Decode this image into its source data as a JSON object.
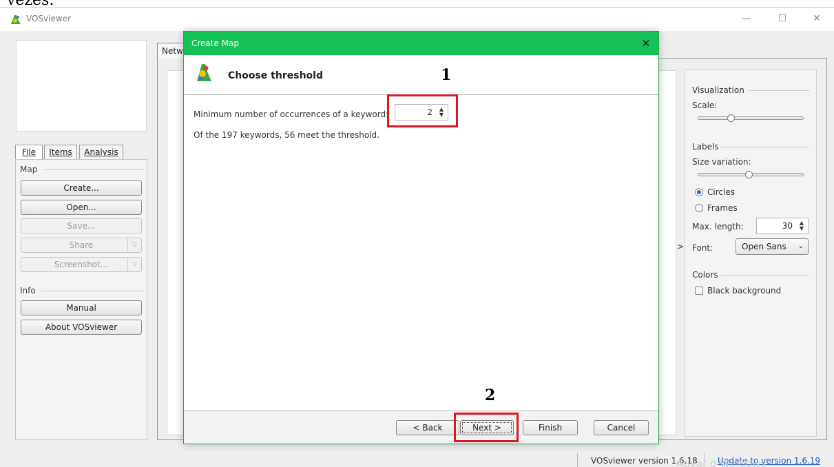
{
  "top_clipped_text": "vezes.",
  "window": {
    "title": "VOSviewer",
    "controls": {
      "minimize": "—",
      "maximize": "☐",
      "close": "✕"
    }
  },
  "left_panel": {
    "tabs": [
      "File",
      "Items",
      "Analysis"
    ],
    "map_group": "Map",
    "buttons": {
      "create": "Create...",
      "open": "Open...",
      "save": "Save...",
      "share": "Share",
      "screenshot": "Screenshot..."
    },
    "info_group": "Info",
    "info_buttons": {
      "manual": "Manual",
      "about": "About VOSviewer"
    }
  },
  "main": {
    "tab_label": "Netw",
    "expand_arrow": ">"
  },
  "right_panel": {
    "visualization": "Visualization",
    "scale": "Scale:",
    "labels": "Labels",
    "size_variation": "Size variation:",
    "circles": "Circles",
    "frames": "Frames",
    "max_length_label": "Max. length:",
    "max_length_value": "30",
    "font_label": "Font:",
    "font_value": "Open Sans",
    "colors": "Colors",
    "black_background": "Black background",
    "scale_level": 0.3,
    "size_variation_level": 0.48
  },
  "dialog": {
    "title": "Create Map",
    "close": "✕",
    "heading": "Choose threshold",
    "field_label": "Minimum number of occurrences of a keyword:",
    "field_value": "2",
    "info_text": "Of the 197 keywords, 56 meet the threshold.",
    "buttons": {
      "back": "< Back",
      "next": "Next >",
      "finish": "Finish",
      "cancel": "Cancel"
    }
  },
  "annotations": {
    "one": "1",
    "two": "2"
  },
  "status": {
    "version": "VOSviewer version 1.6.18",
    "update_link": "Update to version 1.6.19",
    "watermark": "Ativar o Windows"
  },
  "colors": {
    "dialog_title_bg": "#16c257",
    "annotation_red": "#e01522",
    "link": "#1a55c8",
    "radio_selected": "#2c6fb8"
  }
}
